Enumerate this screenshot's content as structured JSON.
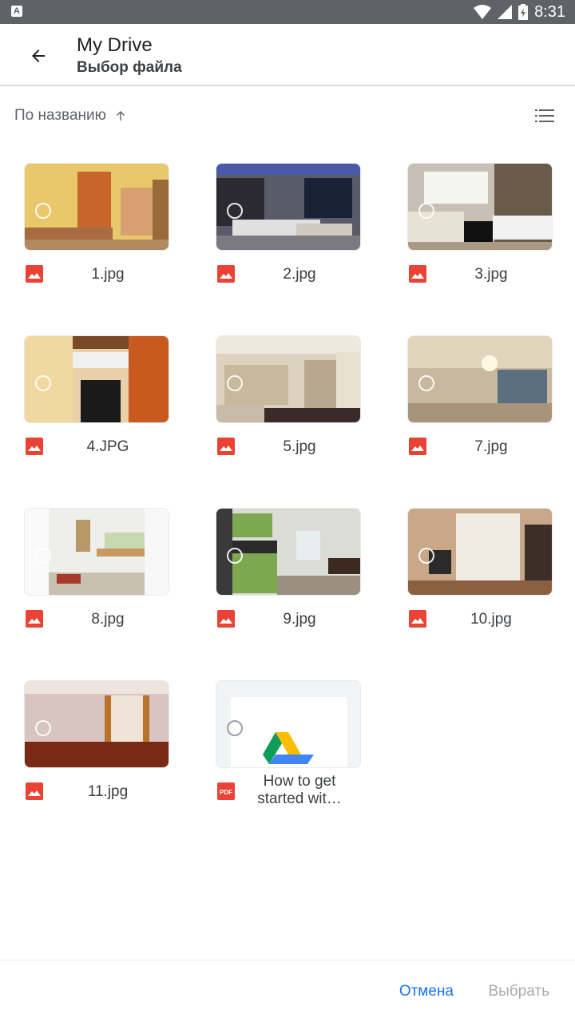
{
  "status_bar": {
    "time": "8:31",
    "notification_icon": "a-notification-icon"
  },
  "header": {
    "title": "My Drive",
    "subtitle": "Выбор файла"
  },
  "sort": {
    "label": "По названию",
    "direction_icon": "arrow-up-icon"
  },
  "files": [
    {
      "name": "1.jpg",
      "type": "image"
    },
    {
      "name": "2.jpg",
      "type": "image"
    },
    {
      "name": "3.jpg",
      "type": "image"
    },
    {
      "name": "4.JPG",
      "type": "image"
    },
    {
      "name": "5.jpg",
      "type": "image"
    },
    {
      "name": "7.jpg",
      "type": "image"
    },
    {
      "name": "8.jpg",
      "type": "image"
    },
    {
      "name": "9.jpg",
      "type": "image"
    },
    {
      "name": "10.jpg",
      "type": "image"
    },
    {
      "name": "11.jpg",
      "type": "image"
    },
    {
      "name": "How to get started wit…",
      "type": "pdf"
    }
  ],
  "footer": {
    "cancel_label": "Отмена",
    "select_label": "Выбрать"
  },
  "colors": {
    "accent": "#1a73e8",
    "image_icon": "#ea4335",
    "pdf_icon": "#ea4335"
  }
}
